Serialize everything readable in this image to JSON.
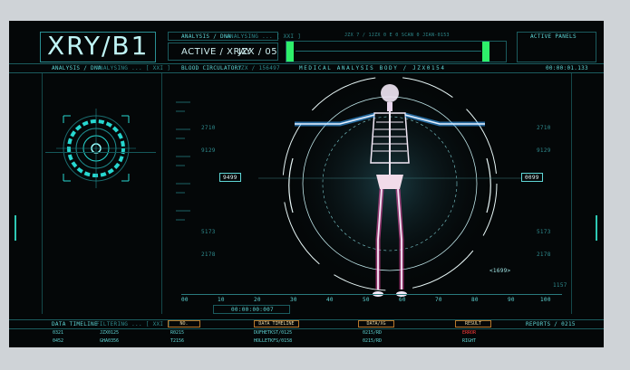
{
  "top": {
    "logo": "XRY/B1",
    "analysis_dna_1": "ANALYSIS / DNA",
    "analysing_1": "ANALYSING ... [ XXI ]",
    "active_xray": "ACTIVE / XRAY",
    "jzx_05": "JZX / 05",
    "active_panels": "ACTIVE PANELS",
    "top_code": "JZX 7 / 1JZX 0 E 0 SCAN 0 JIAN-0153"
  },
  "row2": {
    "analysis_dna_2": "ANALYSIS / DNA",
    "analysing_2": "ANALYSING ... [ XXI ]",
    "blood": "BLOOD CIRCULATORY",
    "blood_code": "JZX / 156497",
    "medical": "MEDICAL ANALYSIS BODY / JZX0154",
    "timer": "00:00:01.133"
  },
  "scan": {
    "left_value": "9499",
    "right_value": "0099",
    "bottom_right": "<1699>",
    "left_ticks": [
      "2710",
      "9129",
      "5173",
      "2178"
    ],
    "right_ticks": [
      "2710",
      "9129",
      "5173",
      "2178"
    ],
    "bottom_right_small": "1157"
  },
  "ruler": {
    "labels": [
      "00",
      "10",
      "20",
      "30",
      "40",
      "50",
      "60",
      "70",
      "80",
      "90",
      "100"
    ],
    "timecode": "00:00:00:007"
  },
  "bottom": {
    "data_timeline_label": "DATA TIMELINE",
    "filtering": "FILTERING ... [ XXI ]",
    "reports": "REPORTS / 0215",
    "headers": [
      "NO.",
      "DATA TIMELINE",
      "DATA/XG",
      "RESULT"
    ],
    "rows": [
      {
        "id": "0321",
        "code": "JZX0125",
        "no": "R0215",
        "timeline": "DUFHETKST/0125",
        "data": "0215/RD",
        "result": "ERROR"
      },
      {
        "id": "0452",
        "code": "GHA0356",
        "no": "T2156",
        "timeline": "HOLLETKFS/0158",
        "data": "0215/RD",
        "result": "RIGHT"
      }
    ]
  },
  "colors": {
    "bg": "#040708",
    "cyan": "#5fd6d6",
    "green": "#2ef06a",
    "error": "#ff3b3b",
    "bone": "#f3e9f7",
    "vessel_blue": "#3aa8ff",
    "vessel_pink": "#ff4fb0"
  }
}
